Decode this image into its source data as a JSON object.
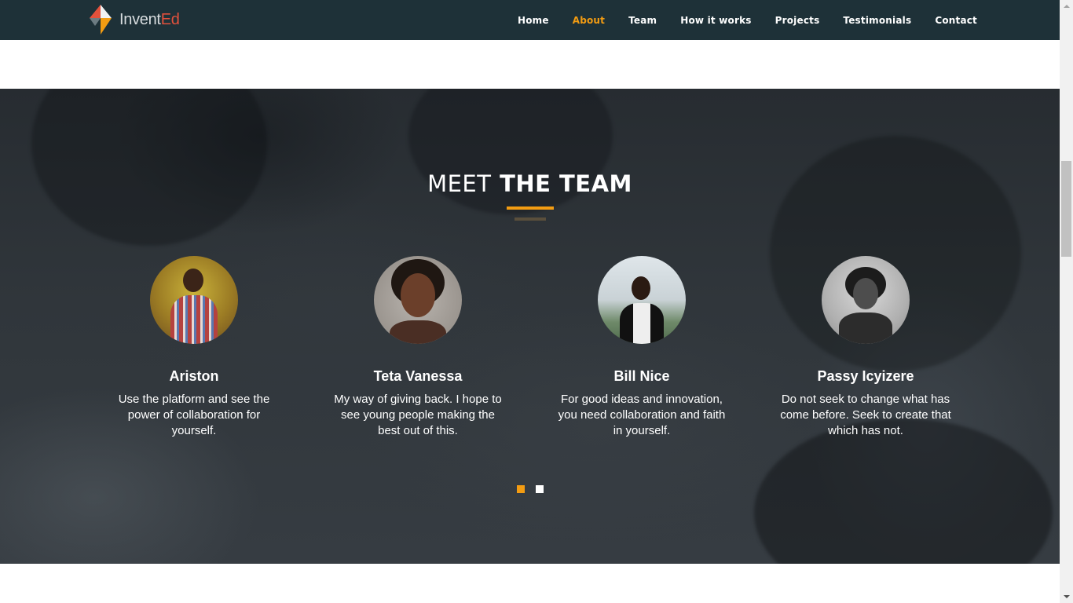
{
  "brand": {
    "name_part1": "Invent",
    "name_part2": "Ed"
  },
  "nav": {
    "items": [
      {
        "label": "Home",
        "active": false
      },
      {
        "label": "About",
        "active": true
      },
      {
        "label": "Team",
        "active": false
      },
      {
        "label": "How it works",
        "active": false
      },
      {
        "label": "Projects",
        "active": false
      },
      {
        "label": "Testimonials",
        "active": false
      },
      {
        "label": "Contact",
        "active": false
      }
    ]
  },
  "team": {
    "title_thin": "MEET",
    "title_bold": "THE TEAM",
    "members": [
      {
        "name": "Ariston",
        "quote": "Use the platform and see the power of collaboration for yourself."
      },
      {
        "name": "Teta Vanessa",
        "quote": "My way of giving back. I hope to see young people making the best out of this."
      },
      {
        "name": "Bill Nice",
        "quote": "For good ideas and innovation, you need collaboration and faith in yourself."
      },
      {
        "name": "Passy Icyizere",
        "quote": "Do not seek to change what has come before. Seek to create that which has not."
      }
    ],
    "carousel": {
      "pages": 2,
      "active_page": 1
    }
  },
  "colors": {
    "navbar_bg": "#1e3138",
    "accent": "#f39c12",
    "brand_red": "#e2513c"
  },
  "icons": {
    "logo": "arrow-kite-logo-icon",
    "scroll_up": "chevron-up-icon",
    "scroll_down": "chevron-down-icon"
  }
}
